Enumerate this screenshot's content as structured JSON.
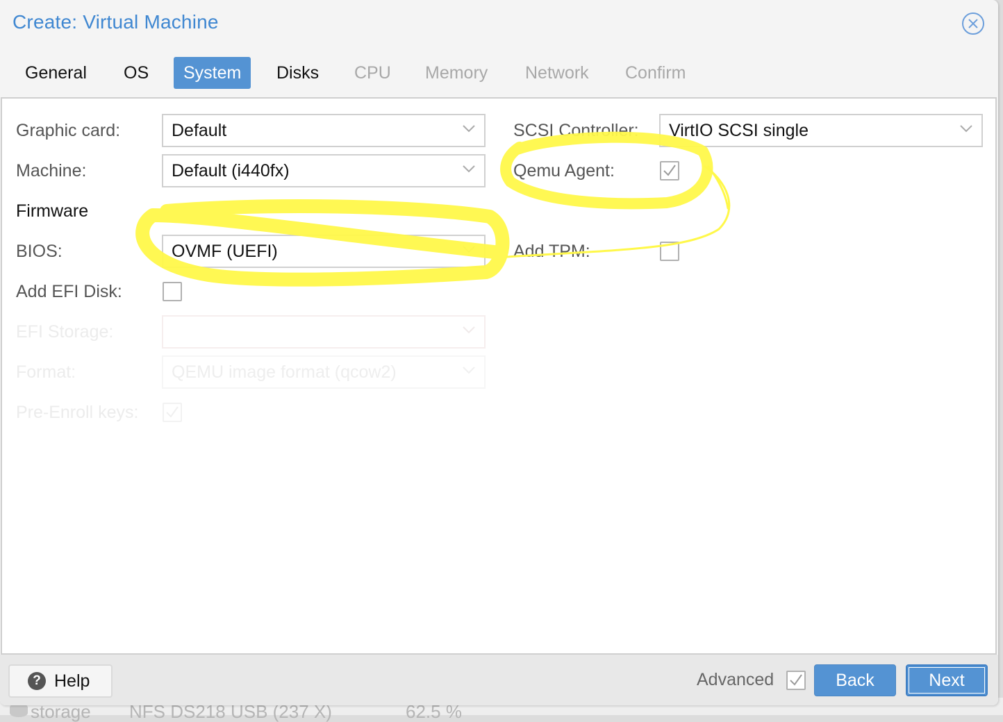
{
  "background": {
    "row_fragments": [
      "storage",
      "NFS DS218 USB (237 X)",
      "62.5 %"
    ]
  },
  "dialog": {
    "title": "Create: Virtual Machine",
    "close_icon": "close-circle-icon"
  },
  "tabs": [
    {
      "label": "General",
      "state": "normal"
    },
    {
      "label": "OS",
      "state": "normal"
    },
    {
      "label": "System",
      "state": "active"
    },
    {
      "label": "Disks",
      "state": "normal"
    },
    {
      "label": "CPU",
      "state": "disabled"
    },
    {
      "label": "Memory",
      "state": "disabled"
    },
    {
      "label": "Network",
      "state": "disabled"
    },
    {
      "label": "Confirm",
      "state": "disabled"
    }
  ],
  "form": {
    "graphic_card": {
      "label": "Graphic card:",
      "value": "Default"
    },
    "machine": {
      "label": "Machine:",
      "value": "Default (i440fx)"
    },
    "firmware_heading": "Firmware",
    "bios": {
      "label": "BIOS:",
      "value": "OVMF (UEFI)"
    },
    "add_efi_disk": {
      "label": "Add EFI Disk:",
      "checked": false
    },
    "efi_storage": {
      "label": "EFI Storage:",
      "value": "",
      "disabled": true
    },
    "format": {
      "label": "Format:",
      "value": "QEMU image format (qcow2)",
      "disabled": true
    },
    "pre_enroll_keys": {
      "label": "Pre-Enroll keys:",
      "checked": true,
      "disabled": true
    },
    "scsi_controller": {
      "label": "SCSI Controller:",
      "value": "VirtIO SCSI single"
    },
    "qemu_agent": {
      "label": "Qemu Agent:",
      "checked": true
    },
    "add_tpm": {
      "label": "Add TPM:",
      "checked": false
    }
  },
  "footer": {
    "help_label": "Help",
    "help_icon": "question-circle-icon",
    "advanced_label": "Advanced",
    "advanced_checked": true,
    "back_label": "Back",
    "next_label": "Next"
  },
  "colors": {
    "accent": "#5493d3",
    "title": "#3f87d1",
    "annotation": "#fff84a"
  },
  "annotations": [
    {
      "type": "highlight-circle",
      "target": "bios"
    },
    {
      "type": "highlight-circle",
      "target": "qemu_agent"
    },
    {
      "type": "highlight-loop",
      "target": "add_tpm"
    }
  ]
}
